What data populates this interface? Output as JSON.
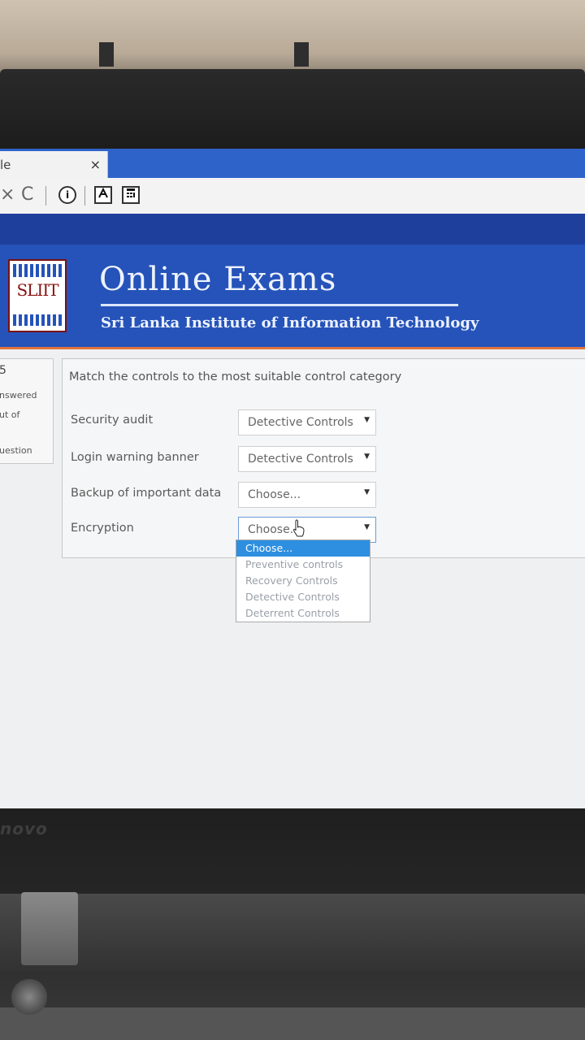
{
  "browser": {
    "tab_title": "le",
    "tab_close": "×",
    "stop_icon": "×",
    "reload_icon": "C",
    "info_icon": "i"
  },
  "header": {
    "logo_text": "SLIIT",
    "title": "Online Exams",
    "subtitle": "Sri Lanka Institute of Information Technology"
  },
  "sidebar": {
    "number": "5",
    "answered": "nswered",
    "out_of": "ut of",
    "question": "uestion"
  },
  "question": {
    "prompt": "Match the controls to the most suitable control category",
    "rows": [
      {
        "label": "Security audit",
        "selected": "Detective Controls"
      },
      {
        "label": "Login warning banner",
        "selected": "Detective Controls"
      },
      {
        "label": "Backup of important data",
        "selected": "Choose..."
      },
      {
        "label": "Encryption",
        "selected": "Choose..."
      }
    ],
    "dropdown_options": [
      "Choose...",
      "Preventive controls",
      "Recovery Controls",
      "Detective Controls",
      "Deterrent Controls"
    ]
  },
  "device": {
    "brand": "novo"
  },
  "colors": {
    "tab_blue": "#2e63c9",
    "banner_blue": "#2553b9",
    "accent_orange": "#e2733c",
    "option_highlight": "#2e8fe0"
  }
}
